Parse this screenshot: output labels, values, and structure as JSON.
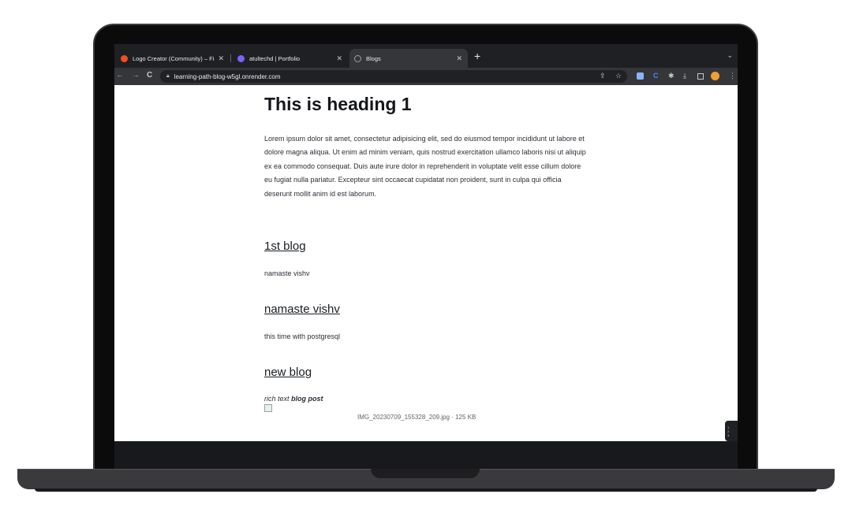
{
  "browser": {
    "tabs": [
      {
        "title": "Logo Creator (Community) – Fi",
        "favicon_color": "#f24e1e",
        "active": false
      },
      {
        "title": "atultechd | Portfolio",
        "favicon_color": "#7b61ff",
        "active": false
      },
      {
        "title": "Blogs",
        "favicon_color": "#9aa0a6",
        "active": true
      }
    ],
    "new_tab_label": "+",
    "tab_menu_label": "⌄",
    "nav": {
      "back": "←",
      "forward": "→",
      "reload": "C"
    },
    "url": "learning-path-blog-w5gl.onrender.com",
    "icons": [
      "share-icon",
      "star-icon",
      "extension-camera-icon",
      "extension-c-icon",
      "puzzle-icon",
      "download-icon",
      "sidepanel-icon",
      "avatar-icon",
      "kebab-menu-icon"
    ]
  },
  "page": {
    "heading": "This is heading 1",
    "intro": "Lorem ipsum dolor sit amet, consectetur adipisicing elit, sed do eiusmod tempor incididunt ut labore et dolore magna aliqua. Ut enim ad minim veniam, quis nostrud exercitation ullamco laboris nisi ut aliquip ex ea commodo consequat. Duis aute irure dolor in reprehenderit in voluptate velit esse cillum dolore eu fugiat nulla pariatur. Excepteur sint occaecat cupidatat non proident, sunt in culpa qui officia deserunt mollit anim id est laborum.",
    "blogs": [
      {
        "title": "1st blog",
        "body": "namaste vishv"
      },
      {
        "title": "namaste vishv",
        "body": "this time with postgresql"
      },
      {
        "title": "new blog",
        "body_italic": "rich text ",
        "body_bold": "blog post"
      }
    ],
    "image_caption": "IMG_20230709_155328_209.jpg · 125 KB",
    "side_widget_text": "1.\n2.\n3."
  }
}
